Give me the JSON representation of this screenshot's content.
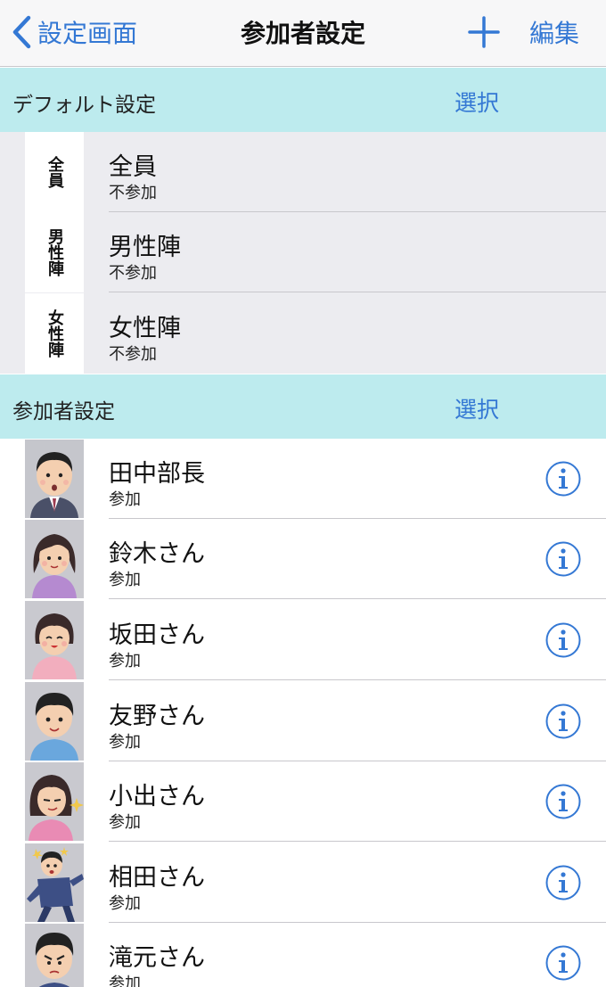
{
  "navbar": {
    "back_label": "設定画面",
    "title": "参加者設定",
    "edit_label": "編集"
  },
  "default_section": {
    "title": "デフォルト設定",
    "select_label": "選択",
    "rows": [
      {
        "badge": "全員",
        "name": "全員",
        "status": "不参加"
      },
      {
        "badge": "男性陣",
        "name": "男性陣",
        "status": "不参加"
      },
      {
        "badge": "女性陣",
        "name": "女性陣",
        "status": "不参加"
      }
    ]
  },
  "participants_section": {
    "title": "参加者設定",
    "select_label": "選択",
    "rows": [
      {
        "name": "田中部長",
        "status": "参加",
        "avatar": "male-manager"
      },
      {
        "name": "鈴木さん",
        "status": "参加",
        "avatar": "female-purple"
      },
      {
        "name": "坂田さん",
        "status": "参加",
        "avatar": "female-pink"
      },
      {
        "name": "友野さん",
        "status": "参加",
        "avatar": "male-blue"
      },
      {
        "name": "小出さん",
        "status": "参加",
        "avatar": "female-smug"
      },
      {
        "name": "相田さん",
        "status": "参加",
        "avatar": "male-falling"
      },
      {
        "name": "滝元さん",
        "status": "参加",
        "avatar": "male-angry"
      }
    ]
  },
  "colors": {
    "accent": "#3478d4",
    "section_bg": "#bdebee",
    "default_bg": "#ececf0"
  }
}
